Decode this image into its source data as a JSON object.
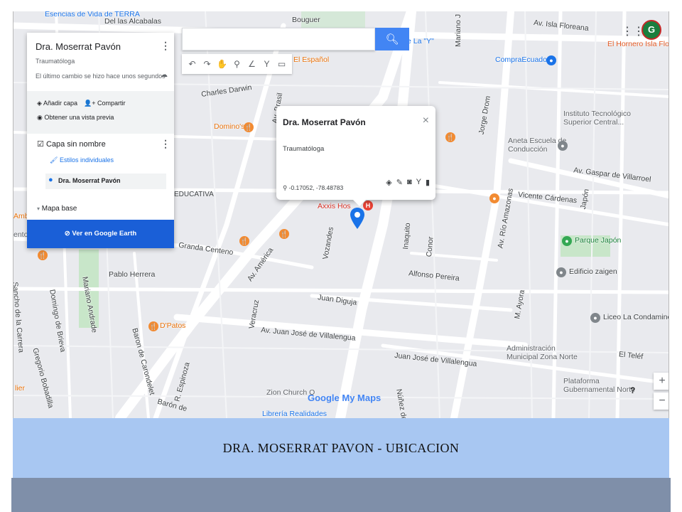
{
  "map": {
    "streets": [
      "Esencias de Vida de TERRA",
      "Del las Alcabalas",
      "Bouguer",
      "Mariano J",
      "Av. Isla Floreana",
      "Charles Darwin",
      "Av. Brasil",
      "Av. América",
      "Jorge Drom",
      "Av. Gaspar de Villarroel",
      "Vicente Cárdenas",
      "Japón",
      "Av. Río Amazonas",
      "Inaquito",
      "Conor",
      "Alfonso Pereira",
      "Vozandes",
      "Juan Diguja",
      "Granda Centeno",
      "Pablo Herrera",
      "Domingo de Brieva",
      "Mariano Andrade",
      "Baron de Carondelet",
      "Av. Juan José de Villalengua",
      "Juan José de Villalengua",
      "Veracruz",
      "Gregorio Bobadilla",
      "Sancho de la Carrera",
      "M. Ayora",
      "El Teléf",
      "Núñez de Vela",
      "R. Espinoza",
      "Barón de",
      "EDUCATIVA",
      "Capa sin nombre"
    ],
    "pois": {
      "hornero": "El Hornero Isla Flore",
      "compra": "CompraEcuador",
      "instituto": "Instituto Tecnológico Superior Central...",
      "aneta": "Aneta Escuela de Conducción",
      "dominos": "Domino's",
      "espanol": "El Español",
      "la_y": "e La \"Y\"",
      "axxis": "Axxis Hos",
      "parque": "Parque Japón",
      "zaigen": "Edificio zaigen",
      "liceo": "Liceo La Condamine",
      "admin": "Administración Municipal Zona Norte",
      "plataforma": "Plataforma Gubernamental Norte",
      "zion": "Zion Church Q",
      "libreria": "Librería Realidades",
      "dpatos": "D'Patos",
      "amb": "Amb",
      "ent": "ento",
      "lier": "lier"
    },
    "branding": "Google My Maps",
    "colors": {
      "road": "#ffffff",
      "block": "#e8eaed",
      "park": "#c8e6c9",
      "accent": "#1a73e8",
      "pin": "#1a73e8",
      "food": "#f28b32"
    }
  },
  "search": {
    "placeholder": "",
    "icon": "search-icon"
  },
  "toolbar": {
    "tools": [
      "undo-icon",
      "redo-icon",
      "hand-icon",
      "marker-icon",
      "draw-line-icon",
      "directions-icon",
      "ruler-icon"
    ]
  },
  "panel": {
    "title": "Dra. Moserrat Pavón",
    "subtitle": "Traumatóloga",
    "last_change": "El último cambio se hizo hace unos segundos",
    "add_layer": "Añadir capa",
    "share": "Compartir",
    "preview": "Obtener una vista previa",
    "layer_name": "Capa sin nombre",
    "styles": "Estilos individuales",
    "item": "Dra. Moserrat Pavón",
    "basemap": "Mapa base",
    "earth_button": "Ver en Google Earth"
  },
  "card": {
    "title": "Dra. Moserrat Pavón",
    "description": "Traumatóloga",
    "coords": "-0.17052, -78.48783",
    "close": "×"
  },
  "zoom": {
    "in": "+",
    "out": "−",
    "help": "?"
  },
  "user": {
    "avatar": "G"
  },
  "caption": "DRA. MOSERRAT  PAVON  -  UBICACION"
}
